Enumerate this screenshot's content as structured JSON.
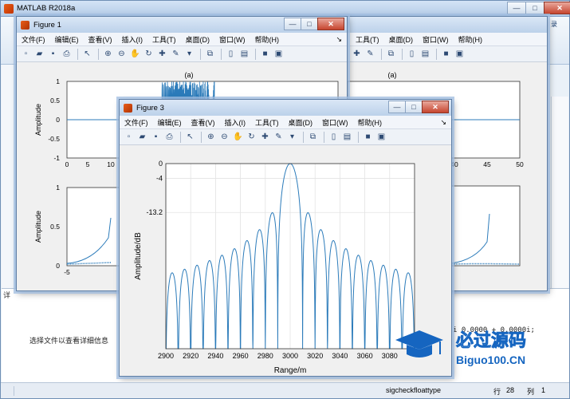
{
  "app": {
    "title": "MATLAB R2018a"
  },
  "menu_items": [
    "文件(F)",
    "编辑(E)",
    "查看(V)",
    "插入(I)",
    "工具(T)",
    "桌面(D)",
    "窗口(W)",
    "帮助(H)"
  ],
  "right_menu_items": [
    "工具(T)",
    "桌面(D)",
    "窗口(W)",
    "帮助(H)"
  ],
  "menu_overflow": "↘",
  "window_controls": {
    "minimize": "—",
    "maximize": "□",
    "close": "✕"
  },
  "figure1": {
    "title": "Figure 1",
    "top_plot": {
      "title": "(a)",
      "ylabel": "Amplitude",
      "yticks": [
        "1",
        "0.5",
        "0",
        "-0.5",
        "-1"
      ],
      "xticks": [
        "0",
        "5",
        "10"
      ]
    },
    "bottom_plot": {
      "ylabel": "Amplitude",
      "yticks": [
        "1",
        "0.5",
        "0"
      ],
      "xticks": [
        "-5"
      ]
    }
  },
  "figure2": {
    "top_plot": {
      "title": "(a)",
      "xticks": [
        "40",
        "45",
        "50"
      ]
    }
  },
  "figure3": {
    "title": "Figure 3",
    "chart_data": {
      "type": "line",
      "xlabel": "Range/m",
      "ylabel": "Amplitude/dB",
      "xlim": [
        2900,
        3100
      ],
      "ylim": [
        -50,
        0
      ],
      "yticks": [
        0,
        -4,
        -13.2
      ],
      "ytick_labels": [
        "0",
        "-4",
        "-13.2"
      ],
      "xticks": [
        2900,
        2920,
        2940,
        2960,
        2980,
        3000,
        3020,
        3040,
        3060,
        3080
      ],
      "xtick_labels": [
        "2900",
        "2920",
        "2940",
        "2960",
        "2980",
        "3000",
        "3020",
        "3040",
        "3060",
        "3080"
      ],
      "grid": true,
      "series": [
        {
          "color": "#2b7bba",
          "center": 3000,
          "null_spacing": 10
        }
      ]
    }
  },
  "workspace": {
    "detail_hint": "选择文件以查看详细信息",
    "command_snippet": "i   0.0000 + 0.0000i;",
    "panel_label": "详"
  },
  "status": {
    "function": "sigcheckfloattype",
    "row_label": "行",
    "row": "28",
    "col_label": "列",
    "col": "1"
  },
  "watermark": {
    "line1": "必过源码",
    "line2": "Biguo100.CN"
  },
  "colors": {
    "line": "#2b7bba",
    "accent": "#1565c0"
  }
}
